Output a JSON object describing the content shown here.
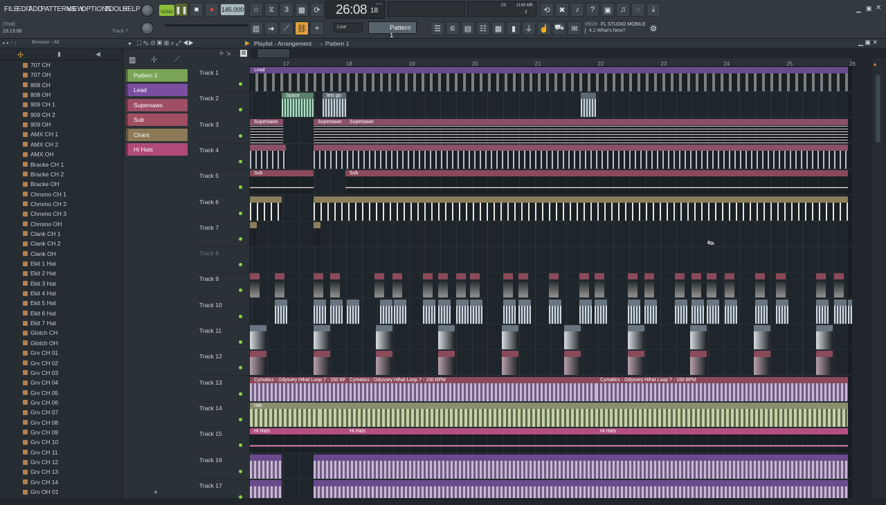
{
  "menu": [
    "FILE",
    "EDIT",
    "ADD",
    "PATTERNS",
    "VIEW",
    "OPTIONS",
    "TOOLS",
    "HELP"
  ],
  "hint": {
    "mode": "(Trial)",
    "time": "23:13:08",
    "track": "Track 7"
  },
  "transport": {
    "song_label": "SONG",
    "tempo": "145.000",
    "time": "26:08",
    "time_small": "18",
    "bst": "B:S:T",
    "cpu": "23",
    "mem": "1148 MB",
    "voices": "3"
  },
  "snap": {
    "value": "Line",
    "pattern": "Pattern 1"
  },
  "news": {
    "count": "09/29",
    "title": "FL STUDIO MOBILE",
    "subtitle": "4.1 What's New?"
  },
  "browser": {
    "title": "Browser - All",
    "items": [
      "707 CH",
      "707 OH",
      "808 CH",
      "808 OH",
      "909 CH 1",
      "909 CH 2",
      "909 OH",
      "AMX CH 1",
      "AMX CH 2",
      "AMX OH",
      "Bracke CH 1",
      "Bracke CH 2",
      "Bracke OH",
      "Chromo CH 1",
      "Chromo CH 2",
      "Chromo CH 3",
      "Chromo OH",
      "Clank CH 1",
      "Clank CH 2",
      "Clank OH",
      "Ekit 1 Hat",
      "Ekit 2 Hat",
      "Ekit 3 Hat",
      "Ekit 4 Hat",
      "Ekit 5 Hat",
      "Ekit 6 Hat",
      "Ekit 7 Hat",
      "Glotch CH",
      "Glotch OH",
      "Grv CH 01",
      "Grv CH 02",
      "Grv CH 03",
      "Grv CH 04",
      "Grv CH 05",
      "Grv CH 06",
      "Grv CH 07",
      "Grv CH 08",
      "Grv CH 09",
      "Grv CH 10",
      "Grv CH 11",
      "Grv CH 12",
      "Grv CH 13",
      "Grv CH 14",
      "Grv OH 01"
    ]
  },
  "playlist": {
    "title": "Playlist - Arrangement",
    "pattern": "Pattern 1",
    "patterns": [
      {
        "name": "Pattern 1",
        "color": "#7aa457"
      },
      {
        "name": "Lead",
        "color": "#7a4fa0"
      },
      {
        "name": "Supersaws",
        "color": "#9e4f66"
      },
      {
        "name": "Sub",
        "color": "#a04f62"
      },
      {
        "name": "Chant",
        "color": "#8b7a55"
      },
      {
        "name": "Hi Hats",
        "color": "#b04a78"
      }
    ],
    "bars": [
      "17",
      "18",
      "19",
      "20",
      "21",
      "22",
      "23",
      "24",
      "25",
      "26"
    ],
    "tracks": [
      "Track 1",
      "Track 2",
      "Track 3",
      "Track 4",
      "Track 5",
      "Track 6",
      "Track 7",
      "Track 8",
      "Track 9",
      "Track 10",
      "Track 11",
      "Track 12",
      "Track 13",
      "Track 14",
      "Track 15",
      "Track 16",
      "Track 17"
    ],
    "clip_labels": {
      "lead": "Lead",
      "space": "Space",
      "letsgo": "lets go",
      "supersaws": "Supersaws",
      "sub": "Sub",
      "cymatics": "Cymatics - Odyssey Hihat Loop 7 - 150 BPM",
      "ride": "ride",
      "hihats": "Hi Hats"
    }
  },
  "colors": {
    "lead": "#6b4a8c",
    "supersaws": "#8a5068",
    "sub": "#8a4a5a",
    "chant": "#8b7e5a",
    "hihat": "#b45080",
    "audio": "#5e6a72"
  }
}
